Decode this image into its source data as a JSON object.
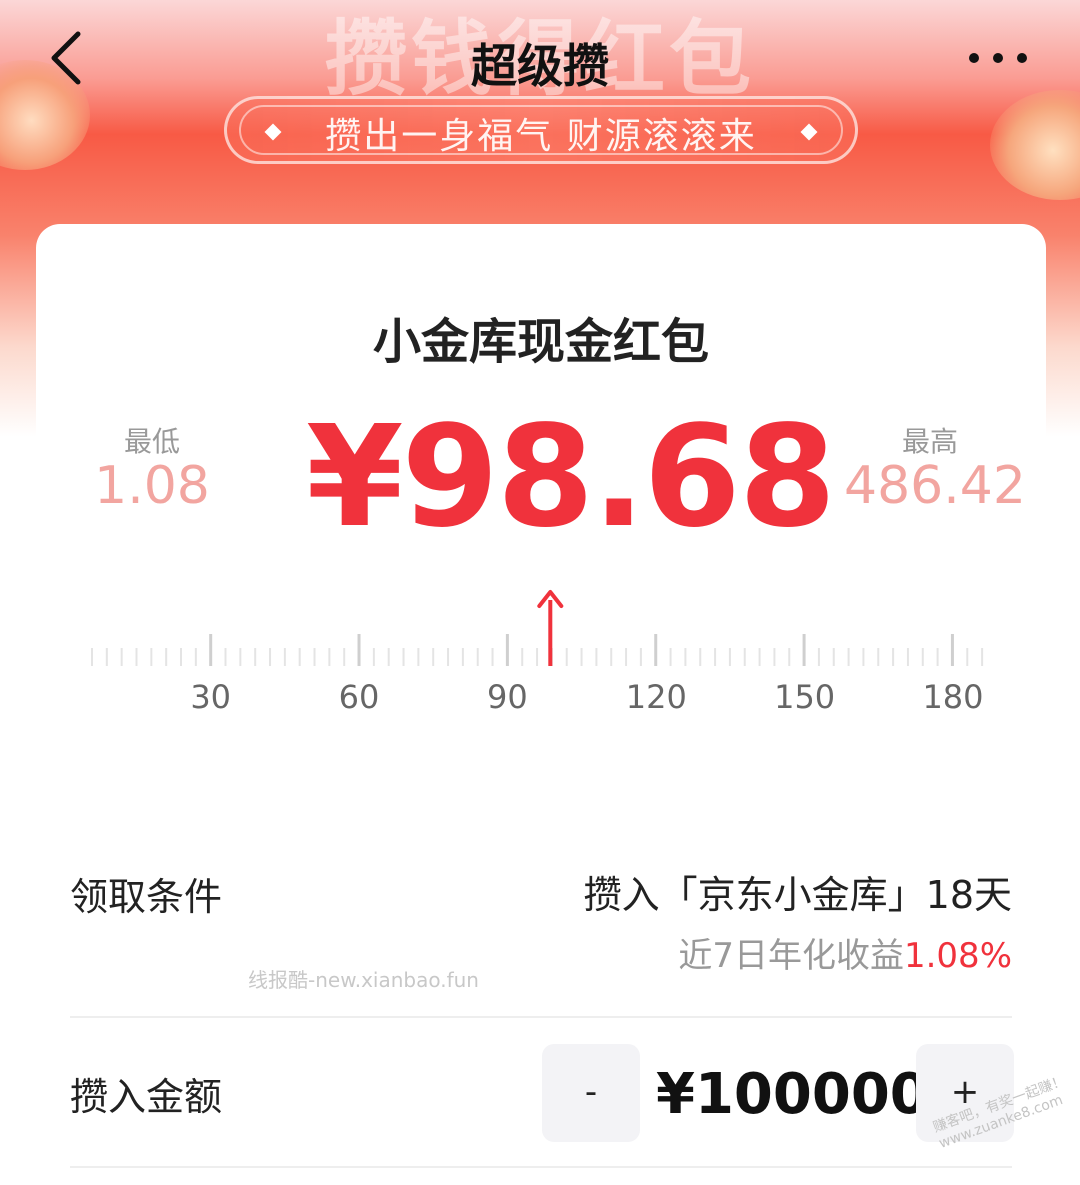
{
  "header": {
    "title": "超级攒",
    "bg_slogan": "攒钱得红包",
    "ribbon_text": "攒出一身福气 财源滚滚来"
  },
  "card": {
    "title": "小金库现金红包",
    "min_label": "最低",
    "min_value": "1.08",
    "max_label": "最高",
    "max_value": "486.42",
    "amount": "¥98.68"
  },
  "ruler": {
    "labels": [
      "30",
      "60",
      "90",
      "120",
      "150",
      "180"
    ],
    "pointer_value": 98.68,
    "start_value": 6,
    "end_value": 188
  },
  "condition": {
    "label": "领取条件",
    "value": "攒入「京东小金库」18天",
    "yield_label": "近7日年化收益",
    "yield_rate": "1.08%"
  },
  "deposit": {
    "label": "攒入金额",
    "minus": "-",
    "value": "¥100000",
    "plus": "+"
  },
  "watermarks": {
    "primary": "线报酷-new.xianbao.fun",
    "secondary_line1": "赚客吧，有奖一起赚！",
    "secondary_line2": "www.zuanke8.com"
  },
  "colors": {
    "accent": "#f0323c",
    "range_value": "#f2a5a0"
  }
}
